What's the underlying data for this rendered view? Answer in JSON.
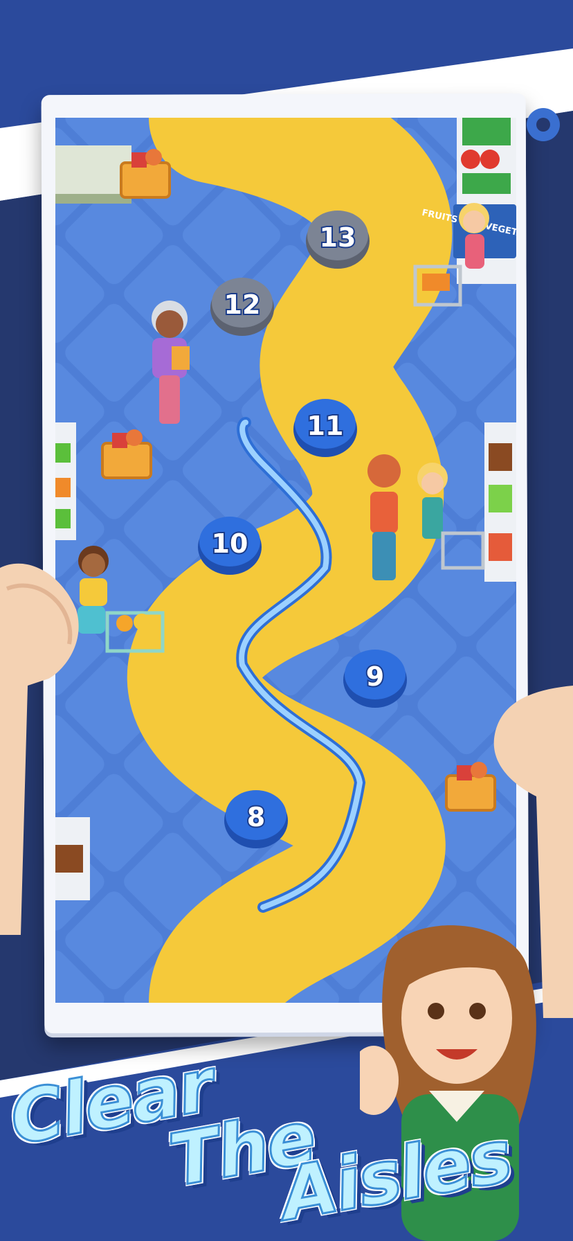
{
  "levels": {
    "items": [
      {
        "label": "8",
        "state": "unlocked"
      },
      {
        "label": "9",
        "state": "unlocked"
      },
      {
        "label": "10",
        "state": "unlocked"
      },
      {
        "label": "11",
        "state": "unlocked"
      },
      {
        "label": "12",
        "state": "locked"
      },
      {
        "label": "13",
        "state": "locked"
      }
    ]
  },
  "shelf_sign": {
    "text": "FRUITS AND VEGETABLES"
  },
  "title": {
    "line1": "Clear",
    "line2": "The",
    "line3": "Aisles"
  },
  "colors": {
    "background": "#2b4a9c",
    "floor": "#4e7ed6",
    "path": "#f5c93a",
    "node_active": "#2f6fde",
    "node_locked": "#7c8494",
    "title_fill": "#bff1ff"
  },
  "icons": [
    "settings-gear-icon",
    "grocery-basket-icon",
    "shopping-cart-icon"
  ]
}
